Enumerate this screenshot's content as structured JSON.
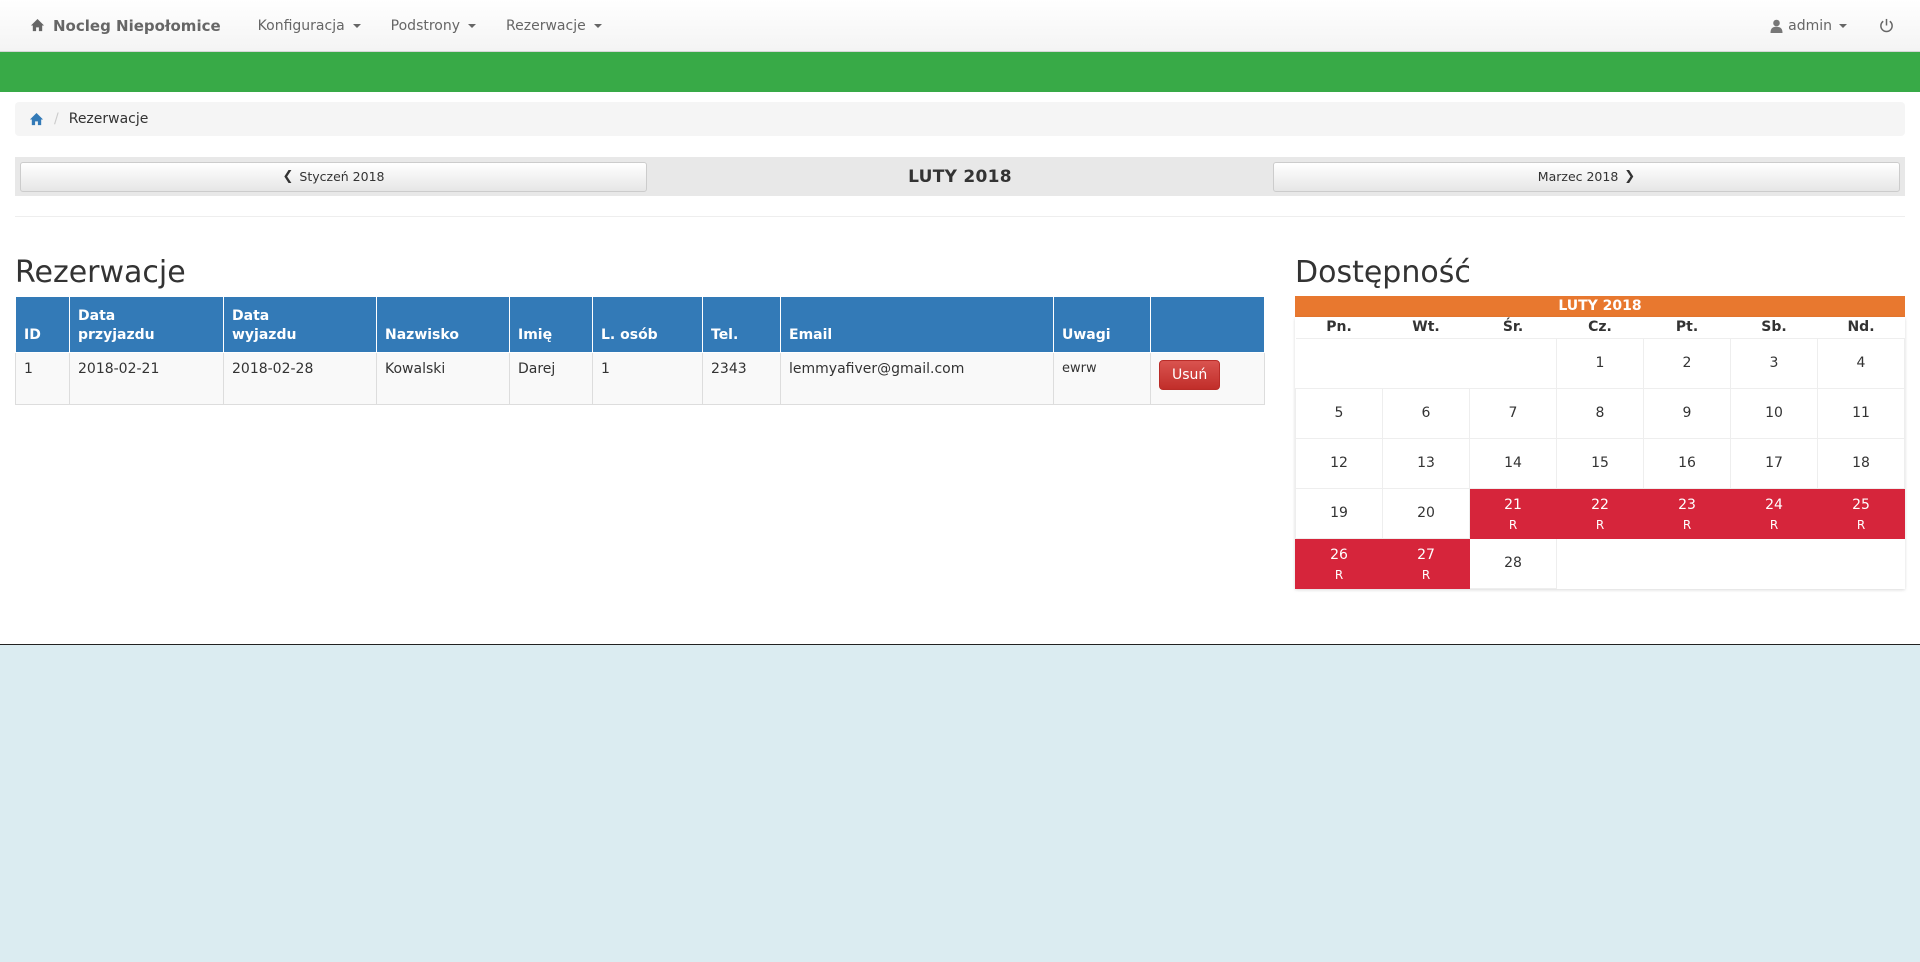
{
  "nav": {
    "brand": "Nocleg Niepołomice",
    "items": [
      "Konfiguracja",
      "Podstrony",
      "Rezerwacje"
    ],
    "user": "admin"
  },
  "breadcrumb": {
    "current": "Rezerwacje"
  },
  "month_nav": {
    "prev": "Styczeń 2018",
    "title": "LUTY 2018",
    "next": "Marzec 2018"
  },
  "reservations": {
    "heading": "Rezerwacje",
    "columns": [
      "ID",
      "Data przyjazdu",
      "Data wyjazdu",
      "Nazwisko",
      "Imię",
      "L. osób",
      "Tel.",
      "Email",
      "Uwagi",
      ""
    ],
    "rows": [
      {
        "id": "1",
        "arrival": "2018-02-21",
        "departure": "2018-02-28",
        "surname": "Kowalski",
        "name": "Darej",
        "persons": "1",
        "tel": "2343",
        "email": "lemmyafiver@gmail.com",
        "notes": "ewrw",
        "action": "Usuń"
      }
    ]
  },
  "availability": {
    "heading": "Dostępność",
    "month": "LUTY 2018",
    "weekdays": [
      "Pn.",
      "Wt.",
      "Śr.",
      "Cz.",
      "Pt.",
      "Sb.",
      "Nd."
    ],
    "reserved_mark": "R",
    "weeks": [
      [
        null,
        null,
        null,
        {
          "d": "1"
        },
        {
          "d": "2"
        },
        {
          "d": "3"
        },
        {
          "d": "4"
        }
      ],
      [
        {
          "d": "5"
        },
        {
          "d": "6"
        },
        {
          "d": "7"
        },
        {
          "d": "8"
        },
        {
          "d": "9"
        },
        {
          "d": "10"
        },
        {
          "d": "11"
        }
      ],
      [
        {
          "d": "12"
        },
        {
          "d": "13"
        },
        {
          "d": "14"
        },
        {
          "d": "15"
        },
        {
          "d": "16"
        },
        {
          "d": "17"
        },
        {
          "d": "18"
        }
      ],
      [
        {
          "d": "19"
        },
        {
          "d": "20"
        },
        {
          "d": "21",
          "r": true
        },
        {
          "d": "22",
          "r": true
        },
        {
          "d": "23",
          "r": true
        },
        {
          "d": "24",
          "r": true
        },
        {
          "d": "25",
          "r": true
        }
      ],
      [
        {
          "d": "26",
          "r": true
        },
        {
          "d": "27",
          "r": true
        },
        {
          "d": "28"
        },
        null,
        null,
        null,
        null
      ]
    ]
  },
  "colors": {
    "navbar_green": "#38aa47",
    "table_header": "#337ab7",
    "calendar_header": "#e8782f",
    "reserved": "#d6253b",
    "delete_button": "#d9534f"
  }
}
